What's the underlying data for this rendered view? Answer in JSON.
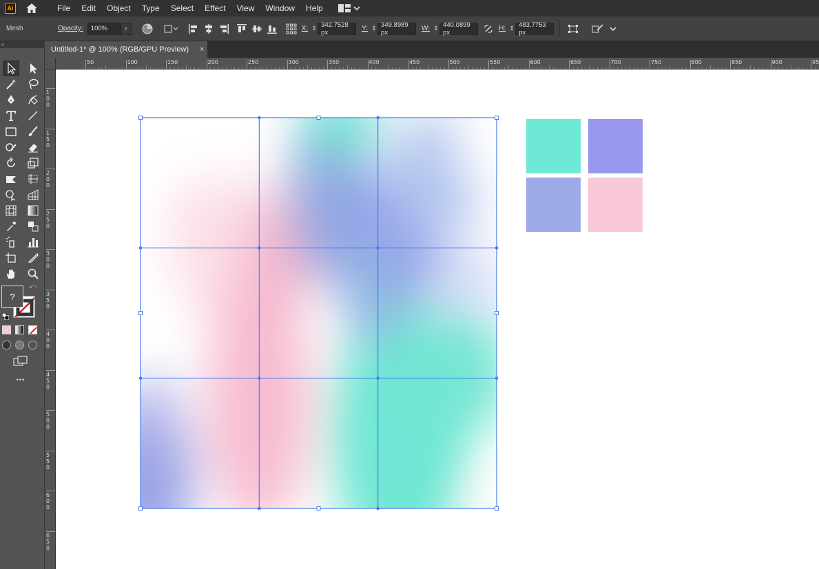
{
  "app": {
    "logo_text": "Ai",
    "menus": [
      "File",
      "Edit",
      "Object",
      "Type",
      "Select",
      "Effect",
      "View",
      "Window",
      "Help"
    ]
  },
  "control": {
    "tool_name": "Mesh",
    "opacity_label": "Opacity:",
    "opacity_value": "100%",
    "x_label": "X:",
    "x_value": "342.7528 px",
    "y_label": "Y:",
    "y_value": "349.8989 px",
    "w_label": "W:",
    "w_value": "440.0899 px",
    "h_label": "H:",
    "h_value": "483.7753 px"
  },
  "document": {
    "tab_title": "Untitled-1* @ 100% (RGB/GPU Preview)",
    "close_glyph": "×"
  },
  "rulers": {
    "horizontal": [
      "50",
      "100",
      "150",
      "200",
      "250",
      "300",
      "350",
      "400",
      "450",
      "500",
      "550",
      "600",
      "650",
      "700",
      "750",
      "800",
      "850",
      "900",
      "950"
    ],
    "vertical": [
      "100",
      "150",
      "200",
      "250",
      "300",
      "350",
      "400",
      "450",
      "500",
      "550",
      "600",
      "650"
    ]
  },
  "toolbar": {
    "unknown_color_glyph": "?",
    "more_glyph": "•••"
  },
  "swatches": {
    "mint": "#6ee9d5",
    "lavender": "#9898ee",
    "periwinkle": "#9eaae5",
    "pink": "#f9c8d6"
  },
  "mesh": {
    "rows": 3,
    "columns": 3,
    "selection_color": "#4a7cf0"
  }
}
